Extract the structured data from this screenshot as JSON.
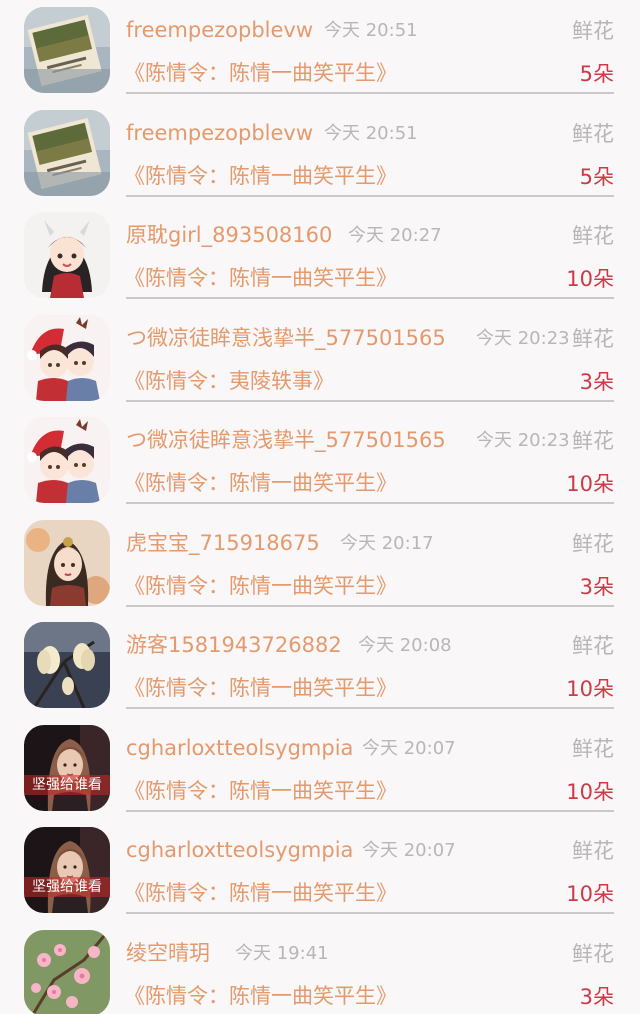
{
  "colors": {
    "accent": "#e49a6c",
    "count": "#cc3a45",
    "muted": "#b6b6b6"
  },
  "items": [
    {
      "name": "freempezopblevw",
      "time": "今天 20:51",
      "gift": "鲜花",
      "book": "《陈情令：陈情一曲笑平生》",
      "count": "5朵",
      "avatar": "book-photo"
    },
    {
      "name": "freempezopblevw",
      "time": "今天 20:51",
      "gift": "鲜花",
      "book": "《陈情令：陈情一曲笑平生》",
      "count": "5朵",
      "avatar": "book-photo"
    },
    {
      "name": "原耽girl_893508160",
      "time": "今天 20:27",
      "gift": "鲜花",
      "book": "《陈情令：陈情一曲笑平生》",
      "count": "10朵",
      "avatar": "anime-girl"
    },
    {
      "name": "つ微凉徒眸意浅挚半_577501565",
      "time": "今天 20:23",
      "gift": "鲜花",
      "book": "《陈情令：夷陵轶事》",
      "count": "3朵",
      "avatar": "anime-christmas"
    },
    {
      "name": "つ微凉徒眸意浅挚半_577501565",
      "time": "今天 20:23",
      "gift": "鲜花",
      "book": "《陈情令：陈情一曲笑平生》",
      "count": "10朵",
      "avatar": "anime-christmas"
    },
    {
      "name": "虎宝宝_715918675",
      "time": "今天 20:17",
      "gift": "鲜花",
      "book": "《陈情令：陈情一曲笑平生》",
      "count": "3朵",
      "avatar": "ancient-lady"
    },
    {
      "name": "游客1581943726882",
      "time": "今天 20:08",
      "gift": "鲜花",
      "book": "《陈情令：陈情一曲笑平生》",
      "count": "10朵",
      "avatar": "magnolia"
    },
    {
      "name": "cgharloxtteolsygmpia",
      "time": "今天 20:07",
      "gift": "鲜花",
      "book": "《陈情令：陈情一曲笑平生》",
      "count": "10朵",
      "avatar": "girl-portrait",
      "avatar_caption": "坚强给谁看"
    },
    {
      "name": "cgharloxtteolsygmpia",
      "time": "今天 20:07",
      "gift": "鲜花",
      "book": "《陈情令：陈情一曲笑平生》",
      "count": "10朵",
      "avatar": "girl-portrait",
      "avatar_caption": "坚强给谁看"
    },
    {
      "name": "绫空晴玥",
      "time": "今天 19:41",
      "gift": "鲜花",
      "book": "《陈情令：陈情一曲笑平生》",
      "count": "3朵",
      "avatar": "pink-blossom"
    }
  ]
}
